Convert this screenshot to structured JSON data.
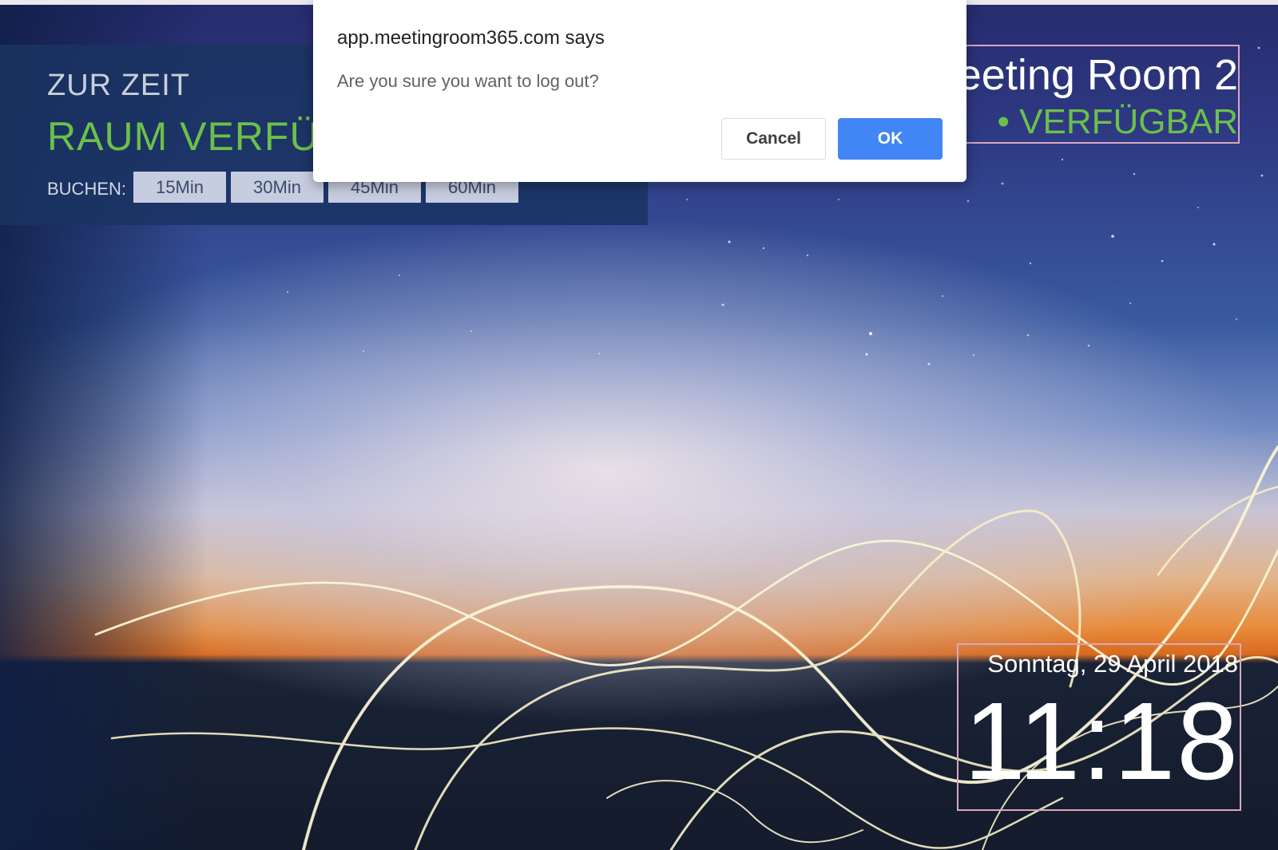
{
  "panel": {
    "status_label": "ZUR ZEIT",
    "status_value": "RAUM VERFÜGBAR",
    "book_label": "BUCHEN:",
    "book_options": [
      "15Min",
      "30Min",
      "45Min",
      "60Min"
    ]
  },
  "room": {
    "name": "Meeting Room 2",
    "status": "• VERFÜGBAR"
  },
  "clock": {
    "date": "Sonntag, 29 April 2018",
    "time": "11:18"
  },
  "dialog": {
    "title": "app.meetingroom365.com says",
    "message": "Are you sure you want to log out?",
    "cancel_label": "Cancel",
    "ok_label": "OK"
  },
  "colors": {
    "accent_green": "#6cc04a",
    "dialog_ok_blue": "#4285f4",
    "frame_pink": "#d8a7c0",
    "panel_navy": "#1a3462"
  }
}
